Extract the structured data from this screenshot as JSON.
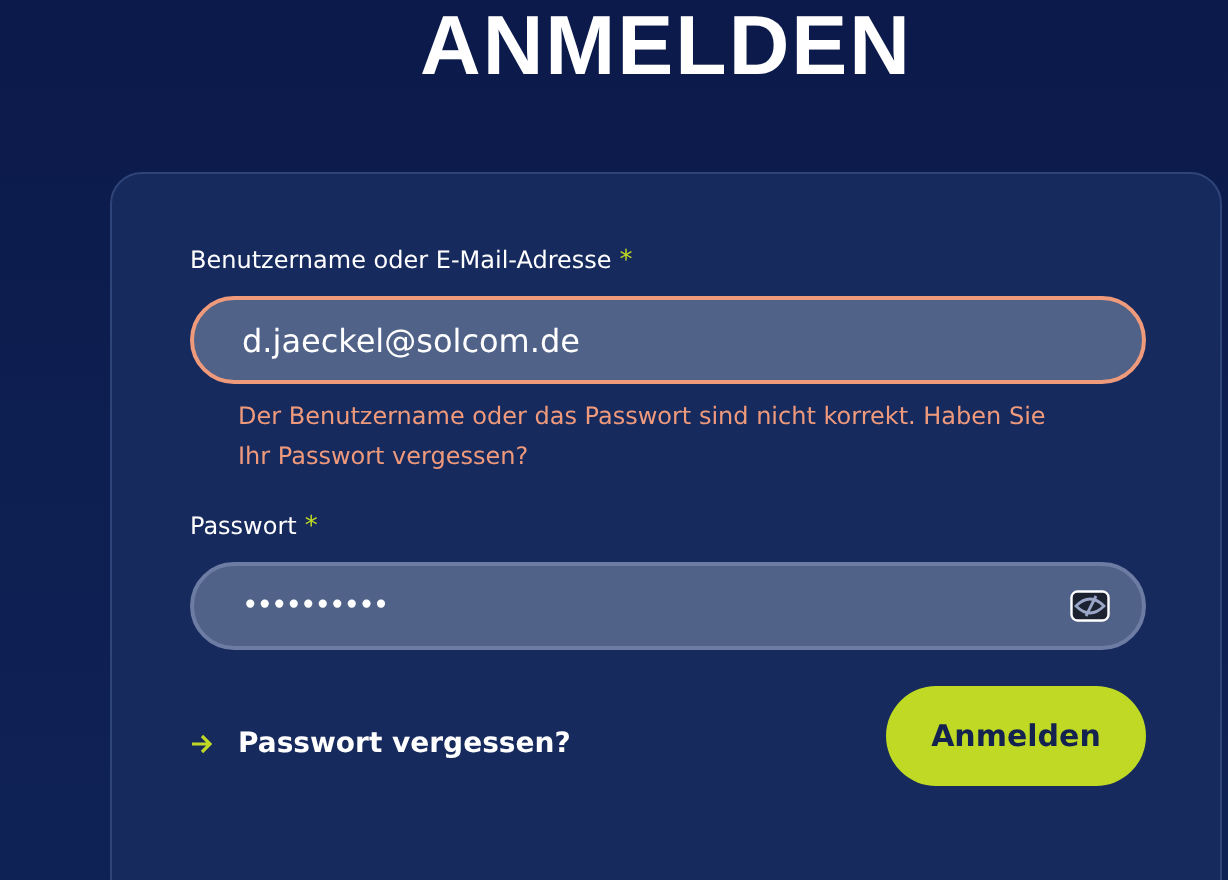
{
  "title": "ANMELDEN",
  "fields": [
    {
      "label": "Benutzername oder E-Mail-Adresse",
      "required_mark": "*",
      "value": "d.jaeckel@solcom.de",
      "error": true,
      "error_text": "Der Benutzername oder das Passwort sind nicht korrekt. Haben Sie Ihr Passwort vergessen?",
      "kind": "text"
    },
    {
      "label": "Passwort",
      "required_mark": "*",
      "value": "••••••••••",
      "error": false,
      "kind": "password"
    }
  ],
  "forgot_link": "Passwort vergessen?",
  "submit_button": "Anmelden"
}
